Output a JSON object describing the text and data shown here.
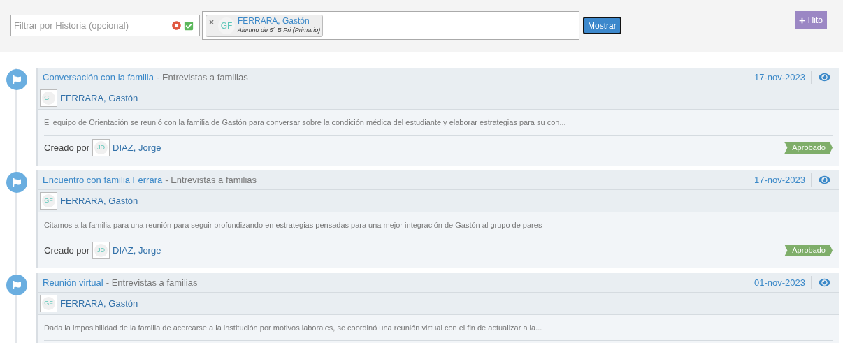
{
  "filter": {
    "placeholder": "Filtrar por Historia (opcional)"
  },
  "selected_student": {
    "remove": "×",
    "initials": "GF",
    "name": "FERRARA, Gastón",
    "detail": "Alumno de 5° B Pri (Primario)"
  },
  "show_button": "Mostrar",
  "add_button": "Hito",
  "entries": [
    {
      "title": "Conversación con la familia",
      "category": "- Entrevistas a familias",
      "date": "17-nov-2023",
      "student": {
        "initials": "GF",
        "name": "FERRARA, Gastón"
      },
      "description": "El equipo de Orientación se reunió con la familia de Gastón para conversar sobre la condición médica del estudiante y elaborar estrategias para su con...",
      "created_label": "Creado por",
      "creator": {
        "initials": "JD",
        "name": "DIAZ, Jorge"
      },
      "status": "Aprobado"
    },
    {
      "title": "Encuentro con familia Ferrara",
      "category": "- Entrevistas a familias",
      "date": "17-nov-2023",
      "student": {
        "initials": "GF",
        "name": "FERRARA, Gastón"
      },
      "description": "Citamos a la familia para una reunión para seguir profundizando en estrategias pensadas para una mejor integración de Gastón al grupo de pares",
      "created_label": "Creado por",
      "creator": {
        "initials": "JD",
        "name": "DIAZ, Jorge"
      },
      "status": "Aprobado"
    },
    {
      "title": "Reunión virtual",
      "category": "- Entrevistas a familias",
      "date": "01-nov-2023",
      "student": {
        "initials": "GF",
        "name": "FERRARA, Gastón"
      },
      "description": "Dada la imposibilidad de la familia de acercarse a la institución por motivos laborales, se coordinó una reunión virtual con el fin de actualizar a la..."
    }
  ]
}
